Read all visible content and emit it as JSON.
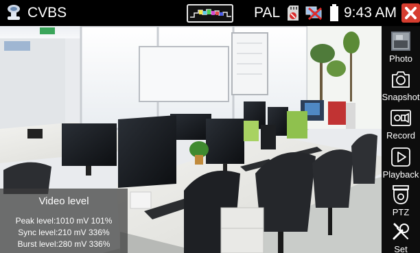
{
  "status_bar": {
    "mode_title": "CVBS",
    "video_standard": "PAL",
    "time": "9:43 AM",
    "icons": [
      "camera-icon",
      "color-bars-icon",
      "sd-card-icon",
      "network-disconnected-icon",
      "battery-icon",
      "close-icon"
    ]
  },
  "video_level": {
    "title": "Video level",
    "peak": "Peak level:1010 mV 101%",
    "sync": "Sync level:210 mV 336%",
    "burst": "Burst level:280 mV 336%"
  },
  "sidebar": {
    "items": [
      {
        "label": "Photo",
        "icon": "photo-thumbnail-icon"
      },
      {
        "label": "Snapshot",
        "icon": "camera-outline-icon"
      },
      {
        "label": "Record",
        "icon": "video-record-icon"
      },
      {
        "label": "Playback",
        "icon": "play-icon"
      },
      {
        "label": "PTZ",
        "icon": "ptz-dome-camera-icon"
      },
      {
        "label": "Set",
        "icon": "tools-icon"
      }
    ]
  },
  "colors": {
    "bar_bg": "#000000",
    "close": "#d63d2f",
    "panel": "#3c3c3c"
  }
}
